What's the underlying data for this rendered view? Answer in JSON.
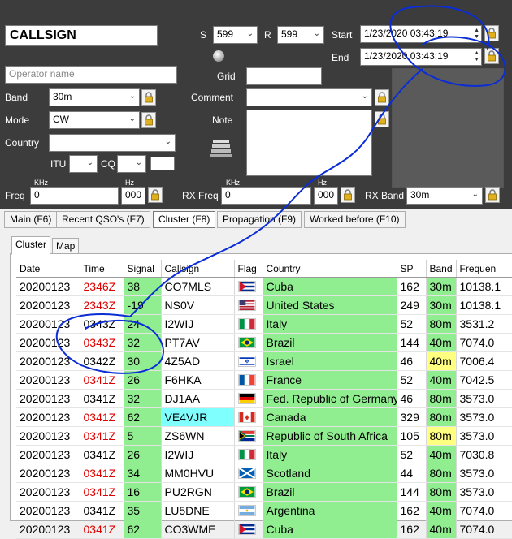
{
  "form": {
    "callsign_value": "CALLSIGN",
    "operator_placeholder": "Operator name",
    "labels": {
      "s": "S",
      "r": "R",
      "start": "Start",
      "end": "End",
      "grid": "Grid",
      "band": "Band",
      "comment": "Comment",
      "mode": "Mode",
      "note": "Note",
      "country": "Country",
      "itu": "ITU",
      "cq": "CQ",
      "freq": "Freq",
      "rx_freq": "RX Freq",
      "rx_band": "RX Band",
      "khz": "KHz",
      "hz": "Hz"
    },
    "s_value": "599",
    "r_value": "599",
    "start_value": "1/23/2020 03:43:19",
    "end_value": "1/23/2020 03:43:19",
    "band_value": "30m",
    "mode_value": "CW",
    "freq_khz": "0",
    "freq_hz": "000",
    "rx_freq_khz": "0",
    "rx_freq_hz": "000",
    "rx_band_value": "30m"
  },
  "tabs": [
    {
      "label": "Main (F6)",
      "active": false
    },
    {
      "label": "Recent QSO's (F7)",
      "active": false
    },
    {
      "label": "Cluster (F8)",
      "active": true
    },
    {
      "label": "Propagation (F9)",
      "active": false
    },
    {
      "label": "Worked before (F10)",
      "active": false
    }
  ],
  "subtabs": [
    {
      "label": "Cluster",
      "active": true
    },
    {
      "label": "Map",
      "active": false
    }
  ],
  "table": {
    "columns": [
      "Date",
      "Time",
      "Signal",
      "Callsign",
      "Flag",
      "Country",
      "SP",
      "Band",
      "Frequen"
    ],
    "rows": [
      {
        "date": "20200123",
        "time": "2346Z",
        "time_red": true,
        "signal": "38",
        "callsign": "CO7MLS",
        "callsign_cyan": false,
        "flag": "cuba",
        "country": "Cuba",
        "sp": "162",
        "band": "30m",
        "band_yellow": false,
        "freq": "10138.1"
      },
      {
        "date": "20200123",
        "time": "2343Z",
        "time_red": true,
        "signal": "-19",
        "callsign": "NS0V",
        "callsign_cyan": false,
        "flag": "usa",
        "country": "United States",
        "sp": "249",
        "band": "30m",
        "band_yellow": false,
        "freq": "10138.1"
      },
      {
        "date": "20200123",
        "time": "0343Z",
        "time_red": false,
        "signal": "24",
        "callsign": "I2WIJ",
        "callsign_cyan": false,
        "flag": "italy",
        "country": "Italy",
        "sp": "52",
        "band": "80m",
        "band_yellow": false,
        "freq": "3531.2"
      },
      {
        "date": "20200123",
        "time": "0343Z",
        "time_red": true,
        "signal": "32",
        "callsign": "PT7AV",
        "callsign_cyan": false,
        "flag": "brazil",
        "country": "Brazil",
        "sp": "144",
        "band": "40m",
        "band_yellow": false,
        "freq": "7074.0"
      },
      {
        "date": "20200123",
        "time": "0342Z",
        "time_red": false,
        "signal": "30",
        "callsign": "4Z5AD",
        "callsign_cyan": false,
        "flag": "israel",
        "country": "Israel",
        "sp": "46",
        "band": "40m",
        "band_yellow": true,
        "freq": "7006.4"
      },
      {
        "date": "20200123",
        "time": "0341Z",
        "time_red": true,
        "signal": "26",
        "callsign": "F6HKA",
        "callsign_cyan": false,
        "flag": "france",
        "country": "France",
        "sp": "52",
        "band": "40m",
        "band_yellow": false,
        "freq": "7042.5"
      },
      {
        "date": "20200123",
        "time": "0341Z",
        "time_red": false,
        "signal": "32",
        "callsign": "DJ1AA",
        "callsign_cyan": false,
        "flag": "germany",
        "country": "Fed. Republic of Germany",
        "sp": "46",
        "band": "80m",
        "band_yellow": false,
        "freq": "3573.0"
      },
      {
        "date": "20200123",
        "time": "0341Z",
        "time_red": true,
        "signal": "62",
        "callsign": "VE4VJR",
        "callsign_cyan": true,
        "flag": "canada",
        "country": "Canada",
        "sp": "329",
        "band": "80m",
        "band_yellow": false,
        "freq": "3573.0"
      },
      {
        "date": "20200123",
        "time": "0341Z",
        "time_red": true,
        "signal": "5",
        "callsign": "ZS6WN",
        "callsign_cyan": false,
        "flag": "southafrica",
        "country": "Republic of South Africa",
        "sp": "105",
        "band": "80m",
        "band_yellow": true,
        "freq": "3573.0"
      },
      {
        "date": "20200123",
        "time": "0341Z",
        "time_red": false,
        "signal": "26",
        "callsign": "I2WIJ",
        "callsign_cyan": false,
        "flag": "italy",
        "country": "Italy",
        "sp": "52",
        "band": "40m",
        "band_yellow": false,
        "freq": "7030.8"
      },
      {
        "date": "20200123",
        "time": "0341Z",
        "time_red": true,
        "signal": "34",
        "callsign": "MM0HVU",
        "callsign_cyan": false,
        "flag": "scotland",
        "country": "Scotland",
        "sp": "44",
        "band": "80m",
        "band_yellow": false,
        "freq": "3573.0"
      },
      {
        "date": "20200123",
        "time": "0341Z",
        "time_red": true,
        "signal": "16",
        "callsign": "PU2RGN",
        "callsign_cyan": false,
        "flag": "brazil",
        "country": "Brazil",
        "sp": "144",
        "band": "80m",
        "band_yellow": false,
        "freq": "3573.0"
      },
      {
        "date": "20200123",
        "time": "0341Z",
        "time_red": false,
        "signal": "35",
        "callsign": "LU5DNE",
        "callsign_cyan": false,
        "flag": "argentina",
        "country": "Argentina",
        "sp": "162",
        "band": "40m",
        "band_yellow": false,
        "freq": "7074.0"
      },
      {
        "date": "20200123",
        "time": "0341Z",
        "time_red": true,
        "signal": "62",
        "callsign": "CO3WME",
        "callsign_cyan": false,
        "flag": "cuba",
        "country": "Cuba",
        "sp": "162",
        "band": "40m",
        "band_yellow": false,
        "freq": "7074.0"
      }
    ]
  },
  "colors": {
    "dark_panel": "#3c3c3c",
    "green_cell": "#90ee90",
    "yellow_cell": "#ffff80",
    "cyan_cell": "#80ffff",
    "red_time": "#e00000",
    "annotation_ink": "#0a2dd6"
  }
}
